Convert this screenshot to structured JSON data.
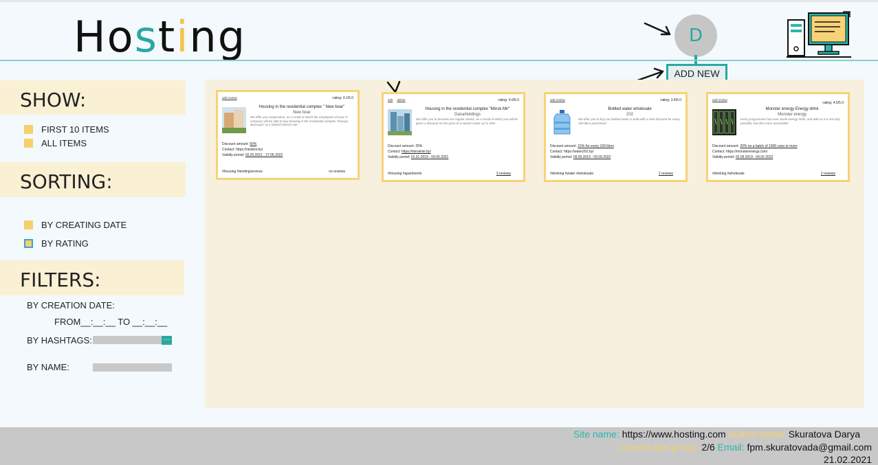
{
  "header": {
    "logo": {
      "part1": "Ho",
      "part2": "s",
      "part3": "t",
      "part4": "i",
      "part5": "ng"
    },
    "avatar_letter": "D",
    "add_button_label": "ADD NEW AD"
  },
  "sidebar": {
    "show": {
      "title": "SHOW:",
      "options": [
        "FIRST 10 ITEMS",
        "ALL ITEMS"
      ]
    },
    "sorting": {
      "title": "SORTING:",
      "options": [
        "BY CREATING DATE",
        "BY RATING"
      ]
    },
    "filters": {
      "title": "FILTERS:",
      "creation_date_label": "BY CREATION DATE:",
      "date_range": "FROM__:__:__ TO __:__:__",
      "hashtags_label": "BY HASHTAGS:",
      "hashtags_button": "···",
      "name_label": "BY NAME:"
    }
  },
  "cards": [
    {
      "action1": "add review",
      "action2": "",
      "rating": "rating: 4.1/5.0",
      "title": "Housing in the residential complex \" New boar\"",
      "subtitle": "New boar",
      "desc": "We offer you cooperation, as a result of which the employees of your IT company will be able to buy housing in the residential complex \"Novaya Borovaya\" at a halved interest rate",
      "discount_label": "Discount amount: ",
      "discount": "50%",
      "contact_label": "Contact: ",
      "contact": "https://newbor.by/",
      "validity_label": "Validity period: ",
      "validity": "02.20.2021 - 27.06.2022",
      "hashtags": "#housing #lendingservices",
      "reviews": "no reviews"
    },
    {
      "action1": "edit",
      "action2": "delete",
      "rating": "rating: 4.0/5.0",
      "title": "Housing in the residential complex \"Minsk Mir\"",
      "subtitle": "DanaHoldings",
      "desc": "We offer you to become our regular clients, as a result of which you will be given a discount on the price of a square meter up to 25%",
      "discount_label": "Discount amount: ",
      "discount": "25%",
      "contact_label": "Contact: ",
      "contact": "https://minskmir.by/",
      "validity_label": "Validity period: ",
      "validity": "01.31.2019 - 09.06.2021",
      "hashtags": "#housing  #apartments",
      "reviews": "3 reviews"
    },
    {
      "action1": "add review",
      "action2": "",
      "rating": "rating: 3.4/5.0",
      "title": "Bottled water wholesale",
      "subtitle": "202",
      "desc": "We offer you to buy our bottled water in bulk with a 15% discount for every 100 liters purchased",
      "discount_label": "Discount amount: ",
      "discount": "15% for every 100 liters",
      "contact_label": "Contact: ",
      "contact": "https://water202.by/",
      "validity_label": "Validity period: ",
      "validity": "09.09.2019 - 09.09.2022",
      "hashtags": "#drinking #water #wholesale",
      "reviews": "2 reviews"
    },
    {
      "action1": "add review",
      "action2": "",
      "rating": "rating: 4.5/5.0",
      "title": "Monster energy Energy drink",
      "subtitle": "Monster energy",
      "desc": "Every programmer has ever drunk energy drink, and with us it is not only possible, but also more accessible!",
      "discount_label": "Discount amount: ",
      "discount": "20% on a batch of 1000 cans or more",
      "contact_label": "Contact: ",
      "contact": "https://monsterenergy.com/",
      "validity_label": "Validity period: ",
      "validity": "02.09.2019 - 09.02.2022",
      "hashtags": "#drinking #wholesale",
      "reviews": "2 reviews"
    }
  ],
  "footer": {
    "site_label": "Site name: ",
    "site": "https://www.hosting.com",
    "author_label": " Author name: ",
    "author": "Skuratova Darya",
    "course_label": "Course and group: ",
    "course": "2/6",
    "email_label": " Email: ",
    "email": "fpm.skuratovada@gmail.com",
    "date": "21.02.2021"
  },
  "colors": {
    "teal": "#2aa8a0",
    "yellow": "#f7cf6b",
    "panel": "#f8f0de",
    "footer": "#c8c8c8"
  }
}
